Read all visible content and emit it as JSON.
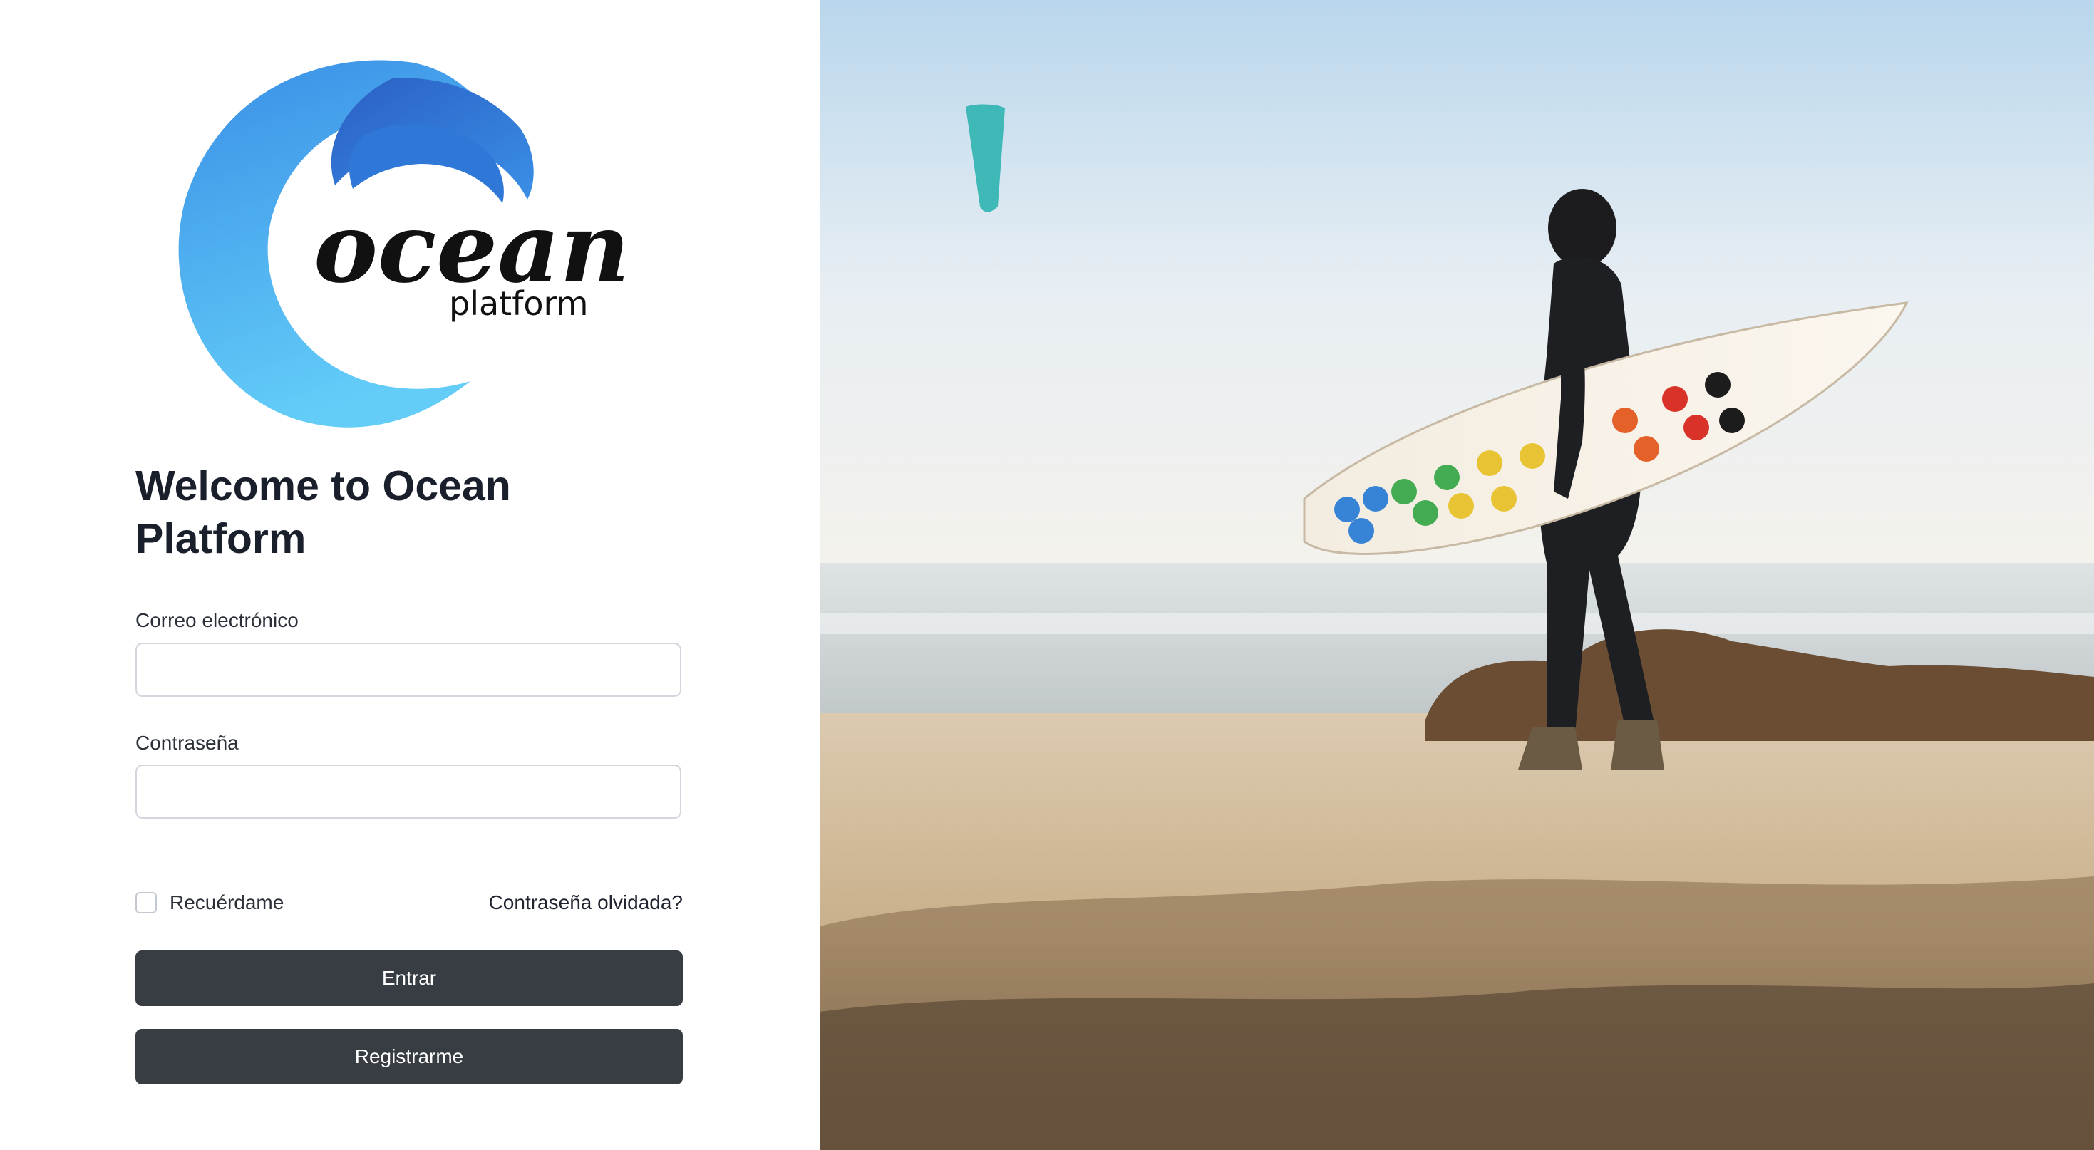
{
  "brand": {
    "logo_word": "ocean",
    "logo_sub": "platform",
    "colors": {
      "wave_light": "#5cc6f5",
      "wave_mid": "#3a8fe6",
      "wave_dark": "#2a5fc4"
    }
  },
  "login": {
    "heading": "Welcome to Ocean Platform",
    "email_label": "Correo electrónico",
    "email_value": "",
    "password_label": "Contraseña",
    "password_value": "",
    "remember_label": "Recuérdame",
    "forgot_label": "Contraseña olvidada?",
    "submit_label": "Entrar",
    "register_label": "Registrarme"
  },
  "hero": {
    "image": "surfer-on-beach-photo"
  },
  "theme": {
    "button_bg": "#383c43",
    "text_color": "#1a1f2c"
  }
}
